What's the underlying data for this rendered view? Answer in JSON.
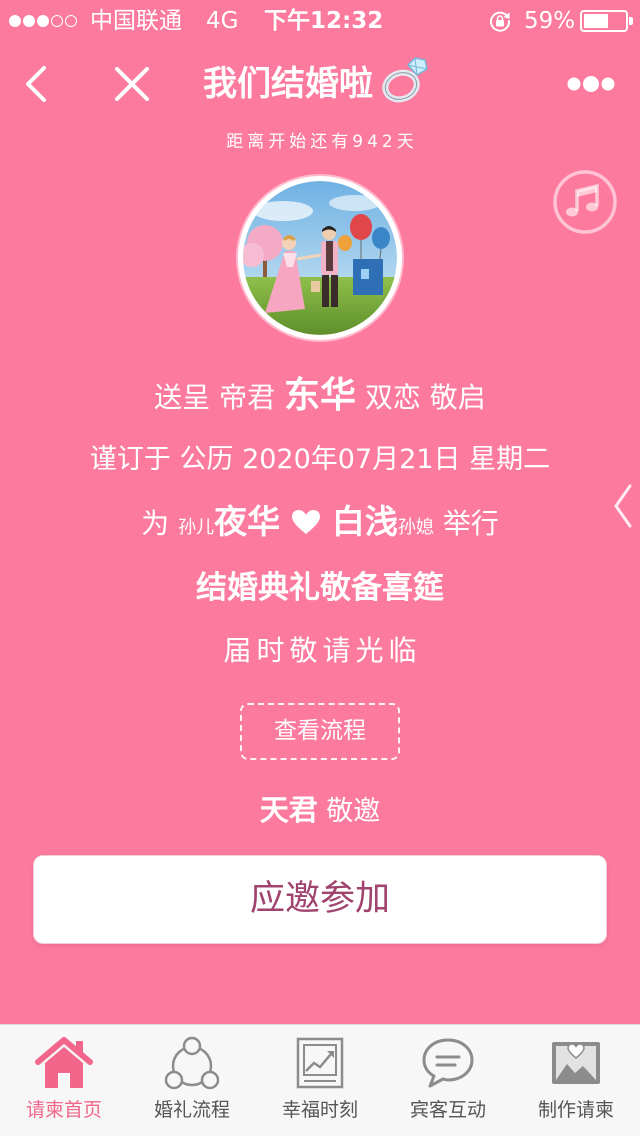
{
  "status_bar": {
    "signal_bars_filled": 3,
    "signal_bars_total": 5,
    "carrier": "中国联通",
    "network": "4G",
    "time": "下午12:32",
    "orientation_lock_icon": "rotation-lock-icon",
    "battery_text": "59%",
    "battery_level": 0.59
  },
  "nav": {
    "back_icon": "chevron-left-icon",
    "close_icon": "close-icon",
    "title": "我们结婚啦",
    "title_icon": "ring-icon",
    "more_icon": "more-dots-icon"
  },
  "countdown": "距离开始还有942天",
  "music_icon": "music-note-icon",
  "invitation": {
    "line1": {
      "before": "送呈 帝君",
      "honoree": "东华",
      "after": "双恋 敬启"
    },
    "line2": "谨订于 公历 2020年07月21日 星期二",
    "line3": {
      "lead": "为",
      "groom_title": "孙儿",
      "groom": "夜华",
      "heart_icon": "heart-icon",
      "bride": "白浅",
      "bride_title": "孙媳",
      "tail": "举行"
    },
    "line4": "结婚典礼敬备喜筵",
    "line5": "届时敬请光临",
    "view_flow_button": "查看流程",
    "signature": {
      "host": "天君",
      "verb": "敬邀"
    },
    "accept_button": "应邀参加"
  },
  "side_drawer_icon": "chevron-left-icon",
  "tabs": [
    {
      "label": "请柬首页",
      "icon": "home-icon",
      "active": true
    },
    {
      "label": "婚礼流程",
      "icon": "connected-circles-icon",
      "active": false
    },
    {
      "label": "幸福时刻",
      "icon": "photo-chart-icon",
      "active": false
    },
    {
      "label": "宾客互动",
      "icon": "chat-bubble-icon",
      "active": false
    },
    {
      "label": "制作请柬",
      "icon": "picture-heart-icon",
      "active": false
    }
  ],
  "colors": {
    "background": "#fd7a9f",
    "accent": "#f2668b",
    "button_text": "#a0436e",
    "tab_label": "#555555",
    "tab_icon": "#8c8c8c"
  }
}
